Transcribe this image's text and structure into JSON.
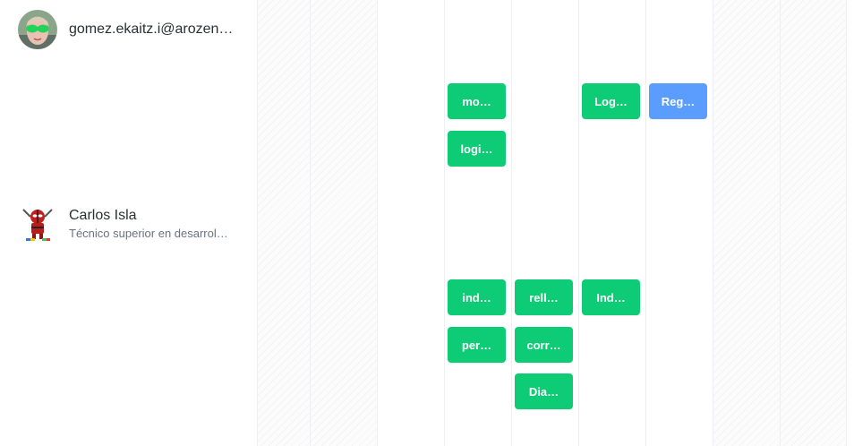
{
  "users": [
    {
      "name": "gomez.ekaitz.i@arozen…",
      "subtitle": ""
    },
    {
      "name": "Carlos Isla",
      "subtitle": "Técnico superior en desarrol…"
    }
  ],
  "chips": {
    "user1": [
      "mo…",
      "logi…",
      "Log…",
      "Reg…"
    ],
    "user2": [
      "ind…",
      "per…",
      "rell…",
      "corr…",
      "Dia…",
      "Ind…"
    ]
  },
  "colors": {
    "chip_green": "#0ecb76",
    "chip_blue": "#5b9dff",
    "grid_line": "#eceff3"
  }
}
